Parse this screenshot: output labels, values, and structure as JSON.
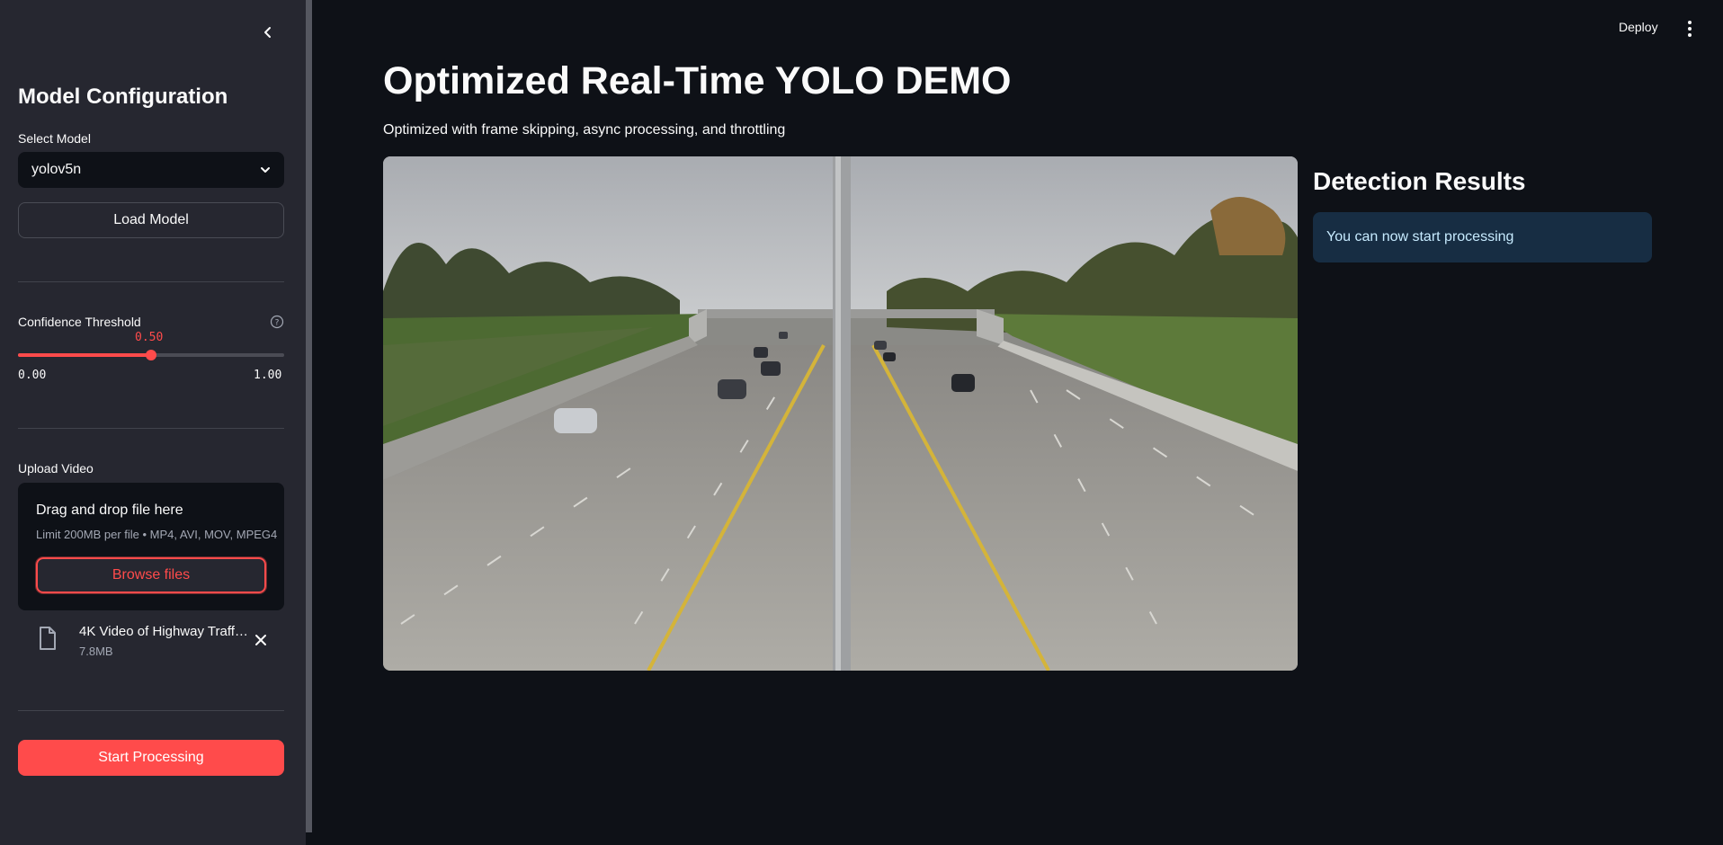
{
  "sidebar": {
    "title": "Model Configuration",
    "select_model": {
      "label": "Select Model",
      "value": "yolov5n"
    },
    "load_button": "Load Model",
    "confidence": {
      "label": "Confidence Threshold",
      "value": "0.50",
      "min": "0.00",
      "max": "1.00",
      "fraction": 0.5
    },
    "upload": {
      "label": "Upload Video",
      "drop_title": "Drag and drop file here",
      "drop_sub": "Limit 200MB per file • MP4, AVI, MOV, MPEG4",
      "browse_button": "Browse files",
      "file_name": "4K Video of Highway Traffic!.mp4",
      "file_size": "7.8MB"
    },
    "start_button": "Start Processing"
  },
  "header": {
    "deploy": "Deploy"
  },
  "main": {
    "title": "Optimized Real-Time YOLO DEMO",
    "subtitle": "Optimized with frame skipping, async processing, and throttling",
    "results_title": "Detection Results",
    "info_message": "You can now start processing"
  },
  "colors": {
    "background": "#0e1117",
    "sidebar": "#262730",
    "accent": "#ff4b4b",
    "info_bg": "#172d43",
    "info_text": "#c7ebff"
  }
}
